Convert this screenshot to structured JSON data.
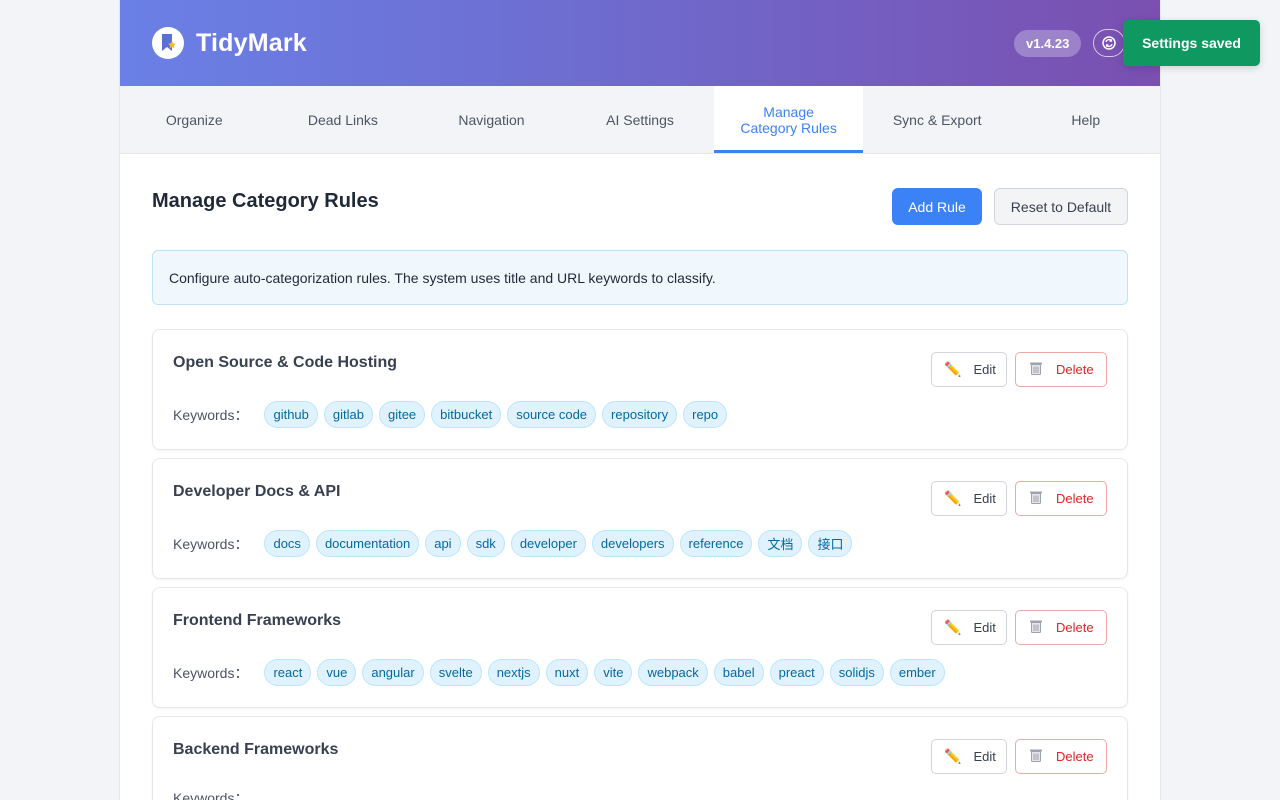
{
  "app": {
    "name": "TidyMark",
    "version": "v1.4.23",
    "sync_icon": "sync-icon"
  },
  "tabs": [
    {
      "label": "Organize",
      "active": false
    },
    {
      "label": "Dead Links",
      "active": false
    },
    {
      "label": "Navigation",
      "active": false
    },
    {
      "label": "AI Settings",
      "active": false
    },
    {
      "label": "Manage Category Rules",
      "label_lines": [
        "Manage",
        "Category Rules"
      ],
      "active": true
    },
    {
      "label": "Sync & Export",
      "active": false
    },
    {
      "label": "Help",
      "active": false
    }
  ],
  "page": {
    "title": "Manage Category Rules",
    "add_button": "Add Rule",
    "reset_button": "Reset to Default",
    "info": "Configure auto-categorization rules. The system uses title and URL keywords to classify."
  },
  "rule_labels": {
    "keywords": "Keywords：",
    "edit": "Edit",
    "delete": "Delete"
  },
  "rules": [
    {
      "name": "Open Source & Code Hosting",
      "keywords": [
        "github",
        "gitlab",
        "gitee",
        "bitbucket",
        "source code",
        "repository",
        "repo"
      ]
    },
    {
      "name": "Developer Docs & API",
      "keywords": [
        "docs",
        "documentation",
        "api",
        "sdk",
        "developer",
        "developers",
        "reference",
        "文档",
        "接口"
      ]
    },
    {
      "name": "Frontend Frameworks",
      "keywords": [
        "react",
        "vue",
        "angular",
        "svelte",
        "nextjs",
        "nuxt",
        "vite",
        "webpack",
        "babel",
        "preact",
        "solidjs",
        "ember"
      ]
    },
    {
      "name": "Backend Frameworks",
      "keywords": []
    }
  ],
  "toast": "Settings saved",
  "colors": {
    "accent": "#3b82f6",
    "header_start": "#6a80e6",
    "header_end": "#7a4fb0",
    "toast": "#0f9960",
    "delete": "#dc2626"
  }
}
